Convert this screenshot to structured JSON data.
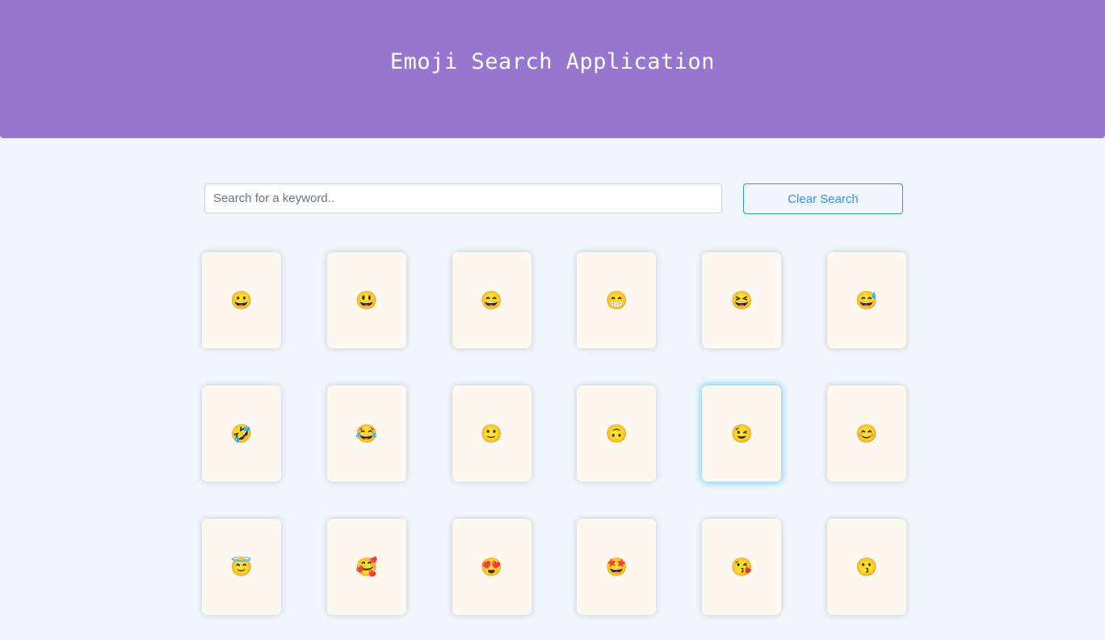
{
  "header": {
    "title": "Emoji Search Application"
  },
  "search": {
    "placeholder": "Search for a keyword..",
    "value": "",
    "clear_label": "Clear Search"
  },
  "emojis": [
    "😀",
    "😃",
    "😄",
    "😁",
    "😆",
    "😅",
    "🤣",
    "😂",
    "🙂",
    "🙃",
    "😉",
    "😊",
    "😇",
    "🥰",
    "😍",
    "🤩",
    "😘",
    "😗"
  ],
  "focused_index": 10,
  "colors": {
    "header": "#9676cf",
    "background": "#eff6fe",
    "card": "#fdf9f0",
    "accent": "#3b8ef0"
  }
}
